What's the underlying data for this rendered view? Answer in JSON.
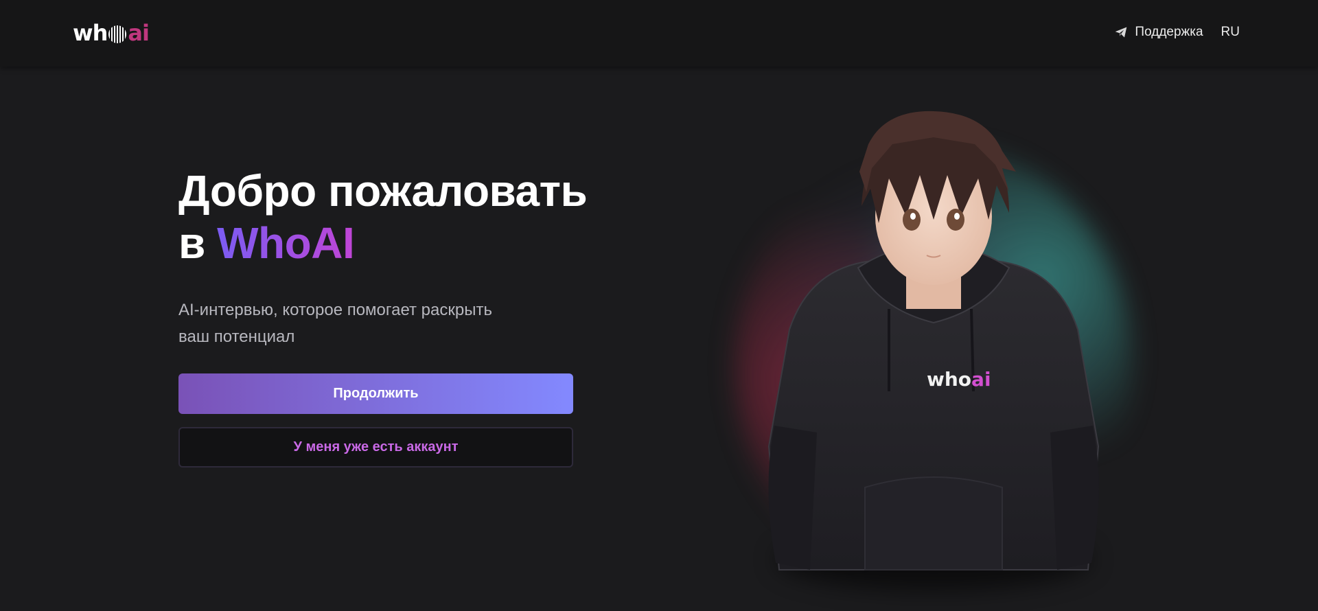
{
  "header": {
    "logo": {
      "part1": "wh",
      "part2": "ai"
    },
    "support_label": "Поддержка",
    "language": "RU"
  },
  "hero": {
    "title_line1": "Добро пожаловать",
    "title_prefix": "в ",
    "title_brand": "WhoAI",
    "subtitle_line1": "AI-интервью, которое помогает раскрыть",
    "subtitle_line2": "ваш потенциал",
    "continue_label": "Продолжить",
    "have_account_label": "У меня уже есть аккаунт"
  },
  "avatar": {
    "hoodie_logo_part1": "who",
    "hoodie_logo_part2": "ai"
  },
  "colors": {
    "background": "#1b1b1d",
    "header": "#161617",
    "accent_gradient_start": "#7a52b7",
    "accent_gradient_end": "#8389ff",
    "secondary_text": "#c969e6",
    "logo_ai": "#c0377e"
  },
  "icons": {
    "support": "telegram-paper-plane-icon"
  }
}
